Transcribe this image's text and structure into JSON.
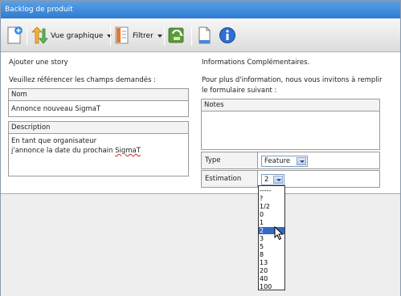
{
  "window": {
    "title": "Backlog de produit"
  },
  "toolbar": {
    "view_label": "Vue graphique",
    "filter_label": "Filtrer",
    "icons": [
      "add-document-icon",
      "sort-arrows-icon",
      "filter-icon",
      "refresh-icon",
      "page-icon",
      "info-icon"
    ]
  },
  "left": {
    "title": "Ajouter une story",
    "instruction": "Veuillez référencer les champs demandés :",
    "name_label": "Nom",
    "name_value": "Annonce nouveau SigmaT",
    "desc_label": "Description",
    "desc_line1": "En tant que organisateur",
    "desc_line2_a": "j'annonce la date du prochain ",
    "desc_line2_b": "SigmaT"
  },
  "right": {
    "title": "Informations Complémentaires.",
    "instruction_line1": "Pour plus d'information, nous vous invitons à remplir",
    "instruction_line2": "le formulaire suivant :",
    "notes_label": "Notes",
    "type_label": "Type",
    "type_value": "Feature",
    "estimation_label": "Estimation",
    "estimation_value": "2"
  },
  "estimation_options": [
    "-----",
    "?",
    "1/2",
    "0",
    "1",
    "2",
    "3",
    "5",
    "8",
    "13",
    "20",
    "40",
    "100"
  ],
  "estimation_selected_index": 5,
  "colors": {
    "titlebar": "#2e7bd0",
    "selection": "#3169c6"
  }
}
